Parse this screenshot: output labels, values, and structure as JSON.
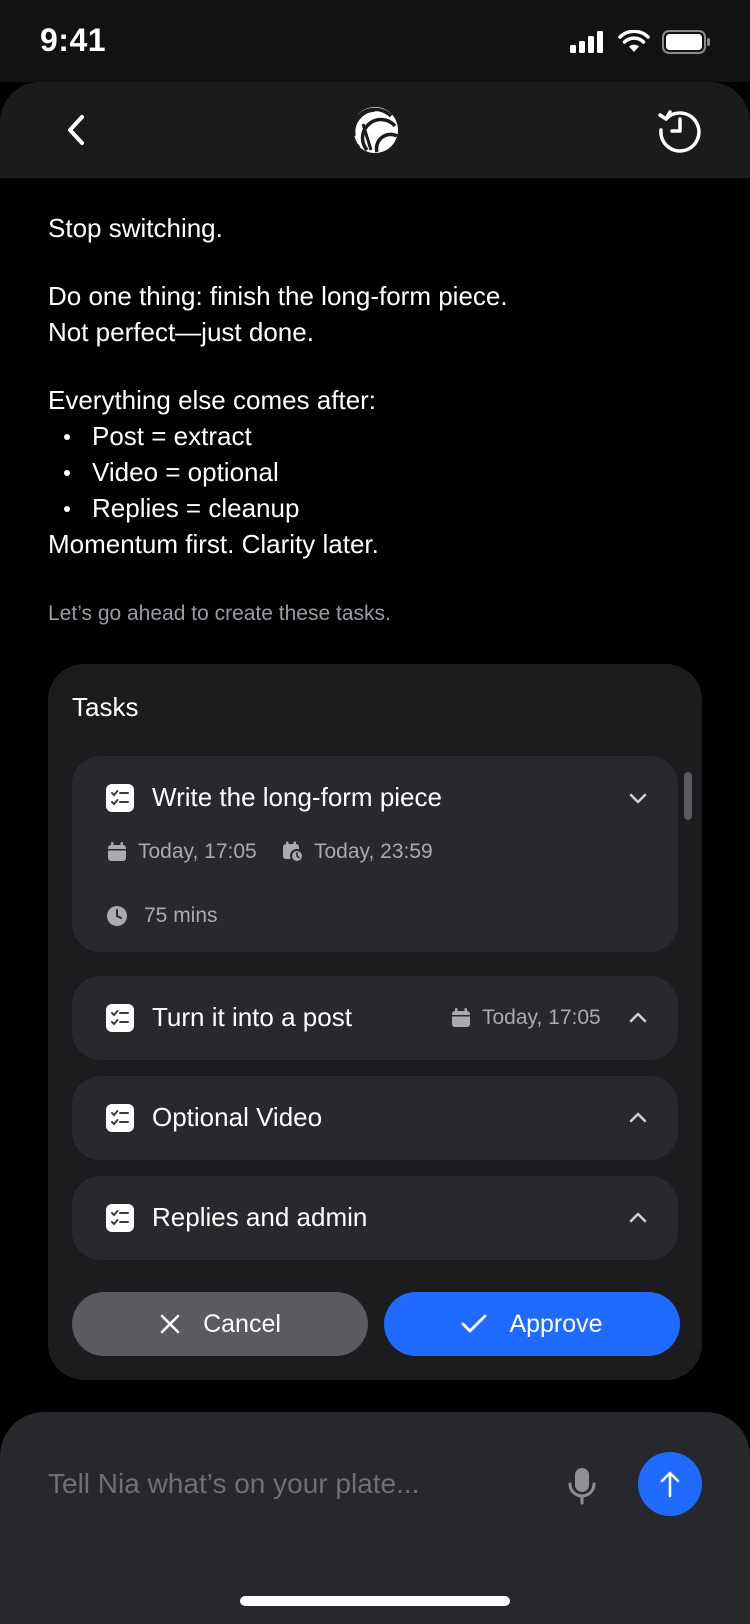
{
  "status_bar": {
    "time": "9:41"
  },
  "message": {
    "line1": "Stop switching.",
    "line2": "Do one thing: finish the long-form piece.",
    "line3": "Not perfect—just done.",
    "line4": "Everything else comes after:",
    "bullets": [
      "Post = extract",
      "Video = optional",
      "Replies = cleanup"
    ],
    "line5": "Momentum first. Clarity later."
  },
  "note": "Let’s go ahead to create these tasks.",
  "tasks": {
    "title": "Tasks",
    "items": [
      {
        "name": "Write the long-form piece",
        "start": "Today, 17:05",
        "due": "Today,  23:59",
        "duration": "75 mins",
        "expanded": true
      },
      {
        "name": "Turn it into a post",
        "start": "Today, 17:05",
        "expanded": false
      },
      {
        "name": "Optional Video",
        "expanded": false
      },
      {
        "name": "Replies and admin",
        "expanded": false
      }
    ]
  },
  "actions": {
    "cancel": "Cancel",
    "approve": "Approve"
  },
  "composer": {
    "placeholder": "Tell Nia what’s on your plate..."
  },
  "colors": {
    "accent": "#1f6bff",
    "card": "#1c1c1e",
    "task": "#28292c",
    "cancel": "#5a5b5e"
  }
}
